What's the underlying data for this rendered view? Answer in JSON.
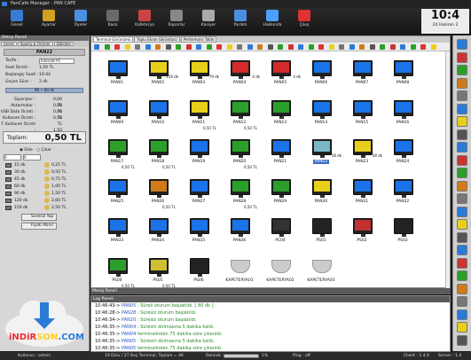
{
  "window": {
    "title": "PanCafe Manager - PAN CAFE"
  },
  "toolbar": [
    {
      "label": "Genel",
      "color": "#3a7bd5"
    },
    {
      "label": "Ayarlar",
      "color": "#d0a020"
    },
    {
      "label": "Üyeler",
      "color": "#4a90e2"
    },
    {
      "label": "Kasa",
      "color": "#6a6a6a"
    },
    {
      "label": "Kafeterya",
      "color": "#c44"
    },
    {
      "label": "Raporlar",
      "color": "#888"
    },
    {
      "label": "Kasiyer",
      "color": "#aaa"
    },
    {
      "label": "Yardım",
      "color": "#4a90e2"
    },
    {
      "label": "Hakkında",
      "color": "#4aa0ff"
    },
    {
      "label": "Çıkış",
      "color": "#d33"
    }
  ],
  "clock": {
    "time": "10:4",
    "date": "24 Haziran 2"
  },
  "left_panel": {
    "title": "Detay Paneli",
    "tabs": [
      "Genel",
      "Sipariş & Ürünler",
      "Dökülen"
    ],
    "pc_name": "PAN22",
    "tariff_label": "Tarife :",
    "tariff_value": "Internet PC",
    "hour_fee_label": "Saat Ücreti :",
    "hour_fee_value": "1,50 TL",
    "start_label": "Başlangıç Saati :",
    "start_value": "10:44",
    "elapsed_label": "Geçen Süre :",
    "elapsed_value": "2 dk",
    "progress": "98 ~ 60 dk",
    "fees": [
      {
        "label": "Siparişler :",
        "value": "0,00 TL"
      },
      {
        "label": "Aktarmalar :",
        "value": "0,00 TL"
      },
      {
        "label": "USB Data Ücreti :",
        "value": "0,00 TL"
      },
      {
        "label": "Kullanım Ücreti :",
        "value": "0,50 TL"
      },
      {
        "label": "T. Kullanım Ücreti :",
        "value": "1,50 TL"
      }
    ],
    "total_label": "Toplam:",
    "total_value": "0,50 TL",
    "radio_in": "Ekle",
    "radio_out": "Çıkar",
    "spin1": "0",
    "spin2": "0",
    "options_left": [
      "15 dk",
      "30 dk",
      "45 dk",
      "60 dk",
      "90 dk",
      "120 dk",
      "150 dk"
    ],
    "options_right": [
      "0,25 TL",
      "0,50 TL",
      "0,75 TL",
      "1,00 TL",
      "1,50 TL",
      "2,00 TL",
      "2,50 TL"
    ],
    "btn_duration": "Süresiz Yap",
    "btn_change": "Fiyatı Atınıl"
  },
  "main_tabs": [
    "Terminal Görünümü",
    "Toplu Ekran Görüntüsü",
    "Performans Tablo"
  ],
  "terminals": [
    {
      "name": "PAN01",
      "color": "#1a73e8",
      "time": "",
      "price": ""
    },
    {
      "name": "PAN02",
      "color": "#e8d01a",
      "time": "159 dk",
      "price": ""
    },
    {
      "name": "PAN03",
      "color": "#e8d01a",
      "time": "79 dk",
      "price": ""
    },
    {
      "name": "PAN04",
      "color": "#d42a2a",
      "time": "4 dk",
      "price": ""
    },
    {
      "name": "PAN05",
      "color": "#d42a2a",
      "time": "4 dk",
      "price": ""
    },
    {
      "name": "PAN06",
      "color": "#1a73e8",
      "time": "",
      "price": ""
    },
    {
      "name": "PAN07",
      "color": "#1a73e8",
      "time": "",
      "price": ""
    },
    {
      "name": "PAN08",
      "color": "#1a73e8",
      "time": "",
      "price": ""
    },
    {
      "name": "PAN09",
      "color": "#1a73e8",
      "time": "",
      "price": ""
    },
    {
      "name": "PAN10",
      "color": "#1a73e8",
      "time": "",
      "price": ""
    },
    {
      "name": "PAN11",
      "color": "#e8d01a",
      "time": "",
      "price": "0,50 TL"
    },
    {
      "name": "PAN12",
      "color": "#2aa02a",
      "time": "",
      "price": "0,50 TL"
    },
    {
      "name": "PAN13",
      "color": "#2aa02a",
      "time": "",
      "price": ""
    },
    {
      "name": "PAN14",
      "color": "#1a73e8",
      "time": "",
      "price": ""
    },
    {
      "name": "PAN15",
      "color": "#1a73e8",
      "time": "",
      "price": ""
    },
    {
      "name": "PAN16",
      "color": "#1a73e8",
      "time": "",
      "price": ""
    },
    {
      "name": "PAN17",
      "color": "#2aa02a",
      "time": "",
      "price": "0,50 TL"
    },
    {
      "name": "PAN18",
      "color": "#2aa02a",
      "time": "",
      "price": "0,50 TL"
    },
    {
      "name": "PAN19",
      "color": "#1a73e8",
      "time": "",
      "price": ""
    },
    {
      "name": "PAN20",
      "color": "#2aa02a",
      "time": "",
      "price": "0,50 TL"
    },
    {
      "name": "PAN21",
      "color": "#1a73e8",
      "time": "",
      "price": ""
    },
    {
      "name": "PAN22",
      "color": "#7ab8c8",
      "time": "58 dk",
      "price": ""
    },
    {
      "name": "PAN23",
      "color": "#e8d01a",
      "time": "38 dk",
      "price": ""
    },
    {
      "name": "PAN24",
      "color": "#1a73e8",
      "time": "",
      "price": ""
    },
    {
      "name": "PAN25",
      "color": "#1a73e8",
      "time": "",
      "price": ""
    },
    {
      "name": "PAN26",
      "color": "#d07a1a",
      "time": "",
      "price": "0,50 TL"
    },
    {
      "name": "PAN27",
      "color": "#1a73e8",
      "time": "",
      "price": ""
    },
    {
      "name": "PAN28",
      "color": "#2aa02a",
      "time": "",
      "price": "0,50 TL"
    },
    {
      "name": "PAN29",
      "color": "#2aa02a",
      "time": "",
      "price": ""
    },
    {
      "name": "PAN30",
      "color": "#e8d01a",
      "time": "",
      "price": ""
    },
    {
      "name": "PAN31",
      "color": "#1a73e8",
      "time": "",
      "price": ""
    },
    {
      "name": "PAN32",
      "color": "#1a73e8",
      "time": "",
      "price": ""
    },
    {
      "name": "PAN33",
      "color": "#1a73e8",
      "time": "",
      "price": ""
    },
    {
      "name": "PAN34",
      "color": "#1a73e8",
      "time": "",
      "price": ""
    },
    {
      "name": "PAN35",
      "color": "#1a73e8",
      "time": "",
      "price": ""
    },
    {
      "name": "PAN36",
      "color": "#1a73e8",
      "time": "",
      "price": ""
    },
    {
      "name": "PC04",
      "color": "#333333",
      "time": "",
      "price": ""
    },
    {
      "name": "PS01",
      "color": "#222222",
      "time": "",
      "price": ""
    },
    {
      "name": "PS02",
      "color": "#c23030",
      "time": "",
      "price": ""
    },
    {
      "name": "PS03",
      "color": "#222222",
      "time": "",
      "price": ""
    },
    {
      "name": "PS04",
      "color": "#2aa02a",
      "time": "",
      "price": "0,50 TL"
    },
    {
      "name": "PS05",
      "color": "#d0c030",
      "time": "",
      "price": "0,50 TL"
    },
    {
      "name": "PS06",
      "color": "#222222",
      "time": "",
      "price": ""
    },
    {
      "name": "KAPETERYA01",
      "color": "#cccccc",
      "time": "",
      "price": ""
    },
    {
      "name": "KAPETERYA02",
      "color": "#cccccc",
      "time": "",
      "price": ""
    },
    {
      "name": "KAPETERYA03",
      "color": "#cccccc",
      "time": "",
      "price": ""
    }
  ],
  "message_panel": "Mesaj Paneli",
  "log_panel": "Log Paneli",
  "logs": [
    {
      "time": "10:46:43->",
      "pc": "PAN05",
      "text": ": Süreli oturum başlatıldı. [ 80 dk ]"
    },
    {
      "time": "10:46:28->",
      "pc": "PAN28",
      "text": ": Süresiz oturum başlatıldı."
    },
    {
      "time": "10:46:34->",
      "pc": "PAN20",
      "text": ": Süresiz oturum başlatıldı."
    },
    {
      "time": "10:46:35->",
      "pc": "PAN04",
      "text": ": Süresin dolmasına 5 dakika kaldı."
    },
    {
      "time": "10:46:35->",
      "pc": "PAN04",
      "text": " terminalinden 75 dakika süre çıkarıldı."
    },
    {
      "time": "10:46:35->",
      "pc": "PAN05",
      "text": ": Süresin dolmasına 5 dakika kaldı."
    },
    {
      "time": "10:46:35->",
      "pc": "PAN05",
      "text": " terminalinden 75 dakika süre çıkarıldı."
    }
  ],
  "status": {
    "user": "Kullanıcı : admin",
    "terminals": "19 Dolu / 27 Boş Terminal, Toplam = 46",
    "fill": "Doluluk :",
    "percent": "1%",
    "ping": "Ping : off",
    "client": "Client : 1.4.0",
    "server": "Server : 1.4"
  },
  "watermark": {
    "pre": "iNDiR",
    "mid": "SON",
    "post": ".COM"
  }
}
